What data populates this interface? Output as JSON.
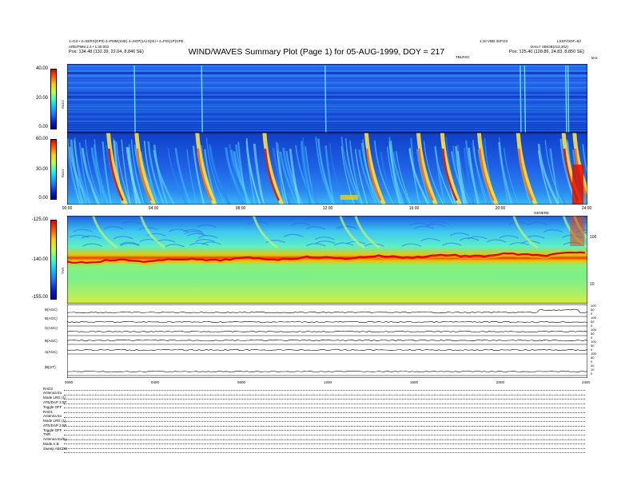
{
  "header": {
    "left_line1": "1=G3 • 3=SERS(GP0) 2=PMM(1ND) 4=SGP(1A) 6(SI) • 4=FIG(1P)GPE",
    "left_line2": "ARE/PMM 2.3 • 1:30:003",
    "left_line3": "Pos:  134.48 (132.39, 22.04, 8.846 SE)",
    "right_line1": "1:10 VBD 3UFO3",
    "right_line2": "LSSF/OOF=6/I",
    "right_line3": "DAILY SBIOB(213,302)",
    "right_line4": "Pos:  125.40 (128.86, 24.83, 8.850 SE)",
    "title": "WIND/WAVES Summary Plot (Page 1) for 05-AUG-1999, DOY = 217",
    "top_right_label": "TBLRSC",
    "khz_label": "kHz"
  },
  "rad2": {
    "name": "RAD2",
    "yticks": [
      "40.00",
      "20.00",
      "0.00"
    ]
  },
  "rad1": {
    "name": "RAD1",
    "yticks": [
      "60.00",
      "30.00",
      "0.00"
    ]
  },
  "time_axis_1": [
    "00:00",
    "04:00",
    "08:00",
    "12:00",
    "16:00",
    "20:00",
    "24:00"
  ],
  "tnr": {
    "name": "TNR",
    "yticks": [
      "-125.00",
      "-140.00",
      "-155.00"
    ],
    "right_ticks": [
      "100",
      "10"
    ],
    "corner_label": "GENERE"
  },
  "lines": {
    "labels": [
      "B(AGC)",
      "B(AGC)",
      "C(AGC)",
      "B(AGC)",
      "A(AGC)",
      "|B|(nT)"
    ],
    "right_ticks": [
      "100",
      "50",
      "0",
      "100",
      "50",
      "0",
      "100",
      "50",
      "0",
      "100",
      "50",
      "0",
      "100",
      "50",
      "0",
      "20",
      "10",
      "0"
    ]
  },
  "time_axis_2": [
    "0000",
    "0400",
    "0800",
    "1200",
    "1600",
    "2000",
    "2400"
  ],
  "info": {
    "block1": [
      "RAD2",
      "Antenna      Ex",
      "Mode    LRG (1)",
      "ATE/DAP  3.5P",
      "Toggle      OFF"
    ],
    "block2": [
      "RAD1",
      "Antenna      Ex",
      "Mode  LRG (1)",
      "ATE/DAP  3.5P",
      "Toggle      OFF",
      "TNR",
      "Antenna    Ex/Ey",
      "Mode          A-B",
      "Sweep  ABCDE"
    ]
  },
  "chart_data": {
    "type": "heatmap",
    "title": "WIND/WAVES Summary Plot (Page 1) for 05-AUG-1999, DOY = 217",
    "xlabel": "",
    "x_ticks": [
      "00:00",
      "04:00",
      "08:00",
      "12:00",
      "16:00",
      "20:00",
      "24:00"
    ],
    "panels": [
      {
        "name": "RAD2",
        "zlim": [
          0,
          40
        ],
        "bursts_hour": [
          3.1,
          6.2,
          11.9,
          20.9,
          21.1,
          23.0,
          23.1
        ]
      },
      {
        "name": "RAD1",
        "zlim": [
          0,
          60
        ],
        "bursts_hour": [
          1.9,
          3.2,
          6.0,
          9.1,
          13.8,
          16.2,
          17.3,
          19.0,
          20.8,
          22.9,
          23.4
        ]
      },
      {
        "name": "TNR",
        "zlim": [
          -155,
          -125
        ],
        "right_axis": [
          "100",
          "10"
        ]
      }
    ]
  }
}
